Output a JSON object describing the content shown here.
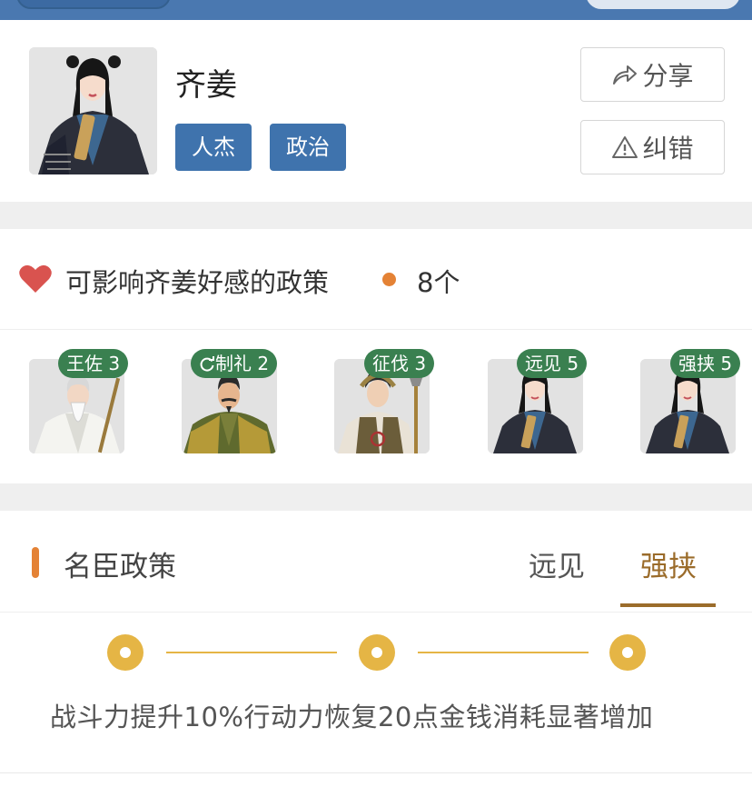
{
  "hero": {
    "name": "齐姜",
    "tags": [
      "人杰",
      "政治"
    ]
  },
  "actions": {
    "share_label": "分享",
    "report_label": "纠错"
  },
  "policy_section": {
    "title": "可影响齐姜好感的政策",
    "count": "8个",
    "heroes": [
      {
        "badge": "王佐 3",
        "portrait": "elder-sage"
      },
      {
        "badge": "制礼 2",
        "portrait": "mustached-minister",
        "badge_icon": "refresh-icon"
      },
      {
        "badge": "征伐 3",
        "portrait": "warrior"
      },
      {
        "badge": "远见 5",
        "portrait": "qi-jiang"
      },
      {
        "badge": "强挟 5",
        "portrait": "qi-jiang"
      }
    ]
  },
  "minister_policy": {
    "title": "名臣政策",
    "tabs": [
      {
        "label": "远见",
        "active": false
      },
      {
        "label": "强挟",
        "active": true
      }
    ],
    "levels": 3,
    "effect": "战斗力提升10%行动力恢复20点金钱消耗显著增加"
  },
  "colors": {
    "header_blue": "#4a78b0",
    "tag_blue": "#3f73ad",
    "badge_green": "#3a8050",
    "accent_orange": "#e48235",
    "active_tab_gold": "#9b6c2b",
    "timeline_gold": "#e5b545",
    "heart_red": "#d9534f"
  }
}
